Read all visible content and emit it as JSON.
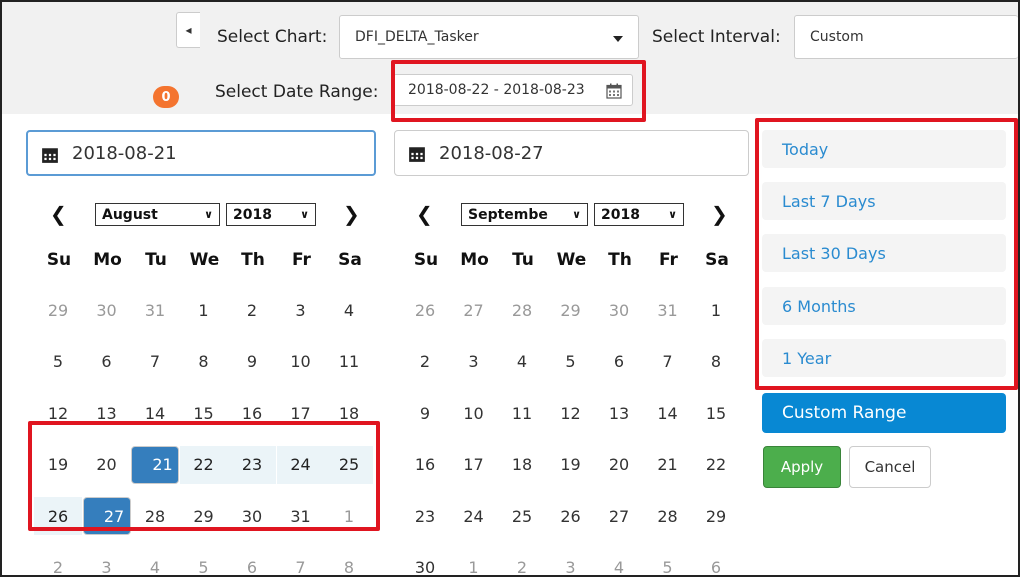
{
  "toolbar": {
    "collapse_glyph": "◂",
    "chart_label": "Select Chart:",
    "chart_value": "DFI_DELTA_Tasker",
    "interval_label": "Select Interval:",
    "interval_value": "Custom",
    "date_range_label": "Select Date Range:",
    "date_range_value": "2018-08-22 - 2018-08-23",
    "badge_count": "0"
  },
  "picker": {
    "start_date": "2018-08-21",
    "end_date": "2018-08-27",
    "left": {
      "month": "August",
      "year": "2018",
      "prev": "❮",
      "next": "❯",
      "weekdays": [
        "Su",
        "Mo",
        "Tu",
        "We",
        "Th",
        "Fr",
        "Sa"
      ],
      "weeks": [
        [
          "29",
          "30",
          "31",
          "1",
          "2",
          "3",
          "4"
        ],
        [
          "5",
          "6",
          "7",
          "8",
          "9",
          "10",
          "11"
        ],
        [
          "12",
          "13",
          "14",
          "15",
          "16",
          "17",
          "18"
        ],
        [
          "19",
          "20",
          "21",
          "22",
          "23",
          "24",
          "25"
        ],
        [
          "26",
          "27",
          "28",
          "29",
          "30",
          "31",
          "1"
        ],
        [
          "2",
          "3",
          "4",
          "5",
          "6",
          "7",
          "8"
        ]
      ]
    },
    "right": {
      "month": "Septembe",
      "year": "2018",
      "prev": "❮",
      "next": "❯",
      "weekdays": [
        "Su",
        "Mo",
        "Tu",
        "We",
        "Th",
        "Fr",
        "Sa"
      ],
      "weeks": [
        [
          "26",
          "27",
          "28",
          "29",
          "30",
          "31",
          "1"
        ],
        [
          "2",
          "3",
          "4",
          "5",
          "6",
          "7",
          "8"
        ],
        [
          "9",
          "10",
          "11",
          "12",
          "13",
          "14",
          "15"
        ],
        [
          "16",
          "17",
          "18",
          "19",
          "20",
          "21",
          "22"
        ],
        [
          "23",
          "24",
          "25",
          "26",
          "27",
          "28",
          "29"
        ],
        [
          "30",
          "1",
          "2",
          "3",
          "4",
          "5",
          "6"
        ]
      ]
    },
    "ranges": [
      "Today",
      "Last 7 Days",
      "Last 30 Days",
      "6 Months",
      "1 Year",
      "Custom Range"
    ],
    "apply_label": "Apply",
    "cancel_label": "Cancel"
  },
  "colors": {
    "highlight_border": "#e01520",
    "selected_day": "#357ebd",
    "in_range": "#ebf4f8",
    "active_range": "#0888d3",
    "apply_button": "#4cae4c",
    "badge": "#f4742f"
  }
}
